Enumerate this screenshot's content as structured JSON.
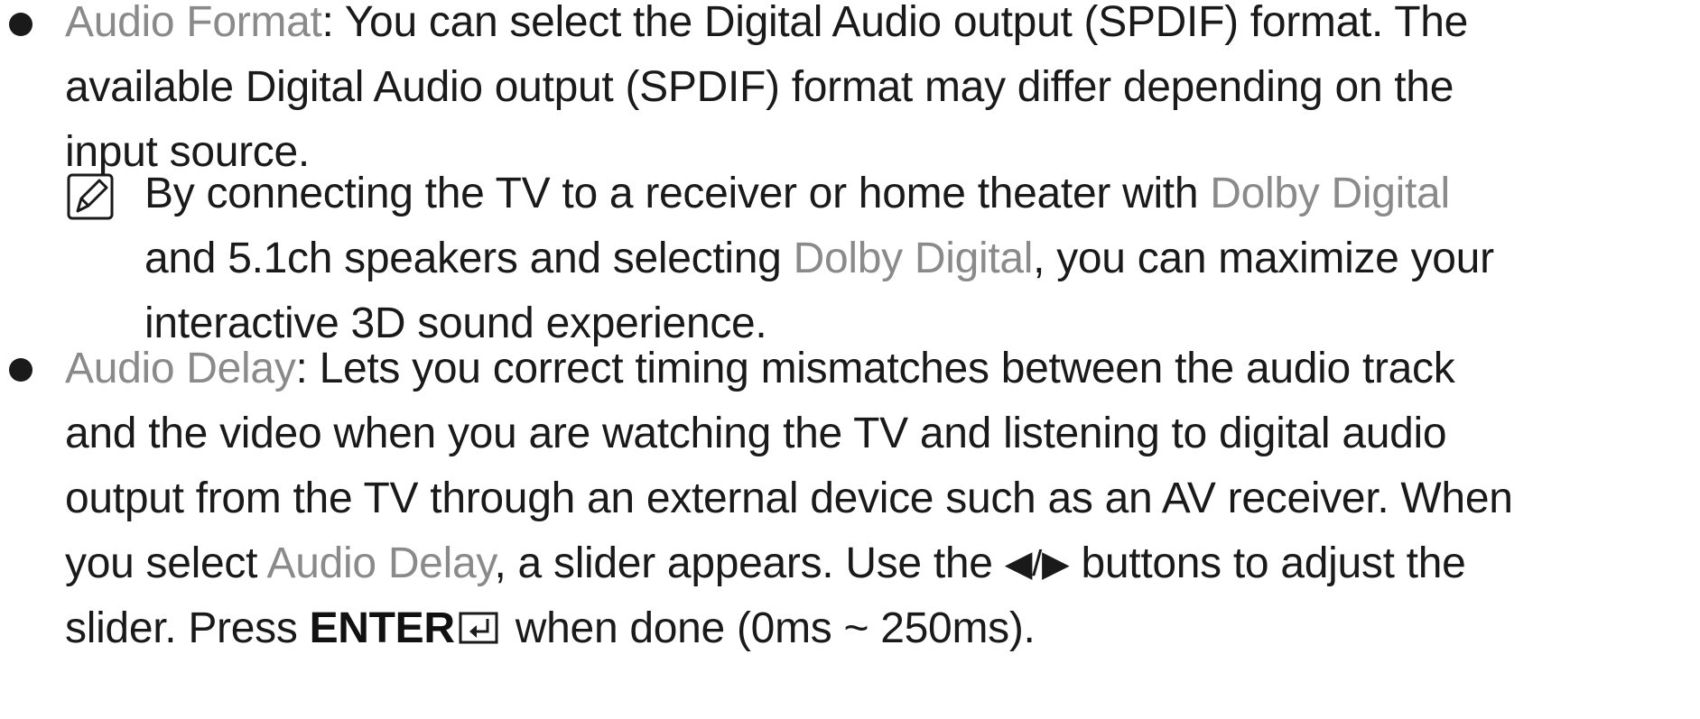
{
  "audio_format": {
    "term": "Audio Format",
    "line1_rest": ": You can select the Digital Audio output (SPDIF) format. The",
    "line2": "available Digital Audio output (SPDIF) format may differ depending on the",
    "line3": "input source."
  },
  "note": {
    "icon": "note-icon",
    "line1_pre": "By connecting the TV to a receiver or home theater with ",
    "term1": "Dolby Digital",
    "line2_pre": "and 5.1ch speakers and selecting ",
    "term2": "Dolby Digital",
    "line2_post": ", you can maximize your",
    "line3": "interactive 3D sound experience."
  },
  "audio_delay": {
    "term": "Audio Delay",
    "line1_rest": ": Lets you correct timing mismatches between the audio track",
    "line2": "and the video when you are watching the TV and listening to digital audio",
    "line3": "output from the TV through an external device such as an AV receiver. When",
    "line4_pre": "you select ",
    "line4_term": "Audio Delay",
    "line4_mid": ", a slider appears. Use the ",
    "arrows": "◀/▶",
    "line4_post": " buttons to adjust the",
    "line5_pre": "slider. Press ",
    "enter_label": "ENTER",
    "enter_icon": "enter-icon",
    "line5_post": " when done (0ms ~ 250ms)."
  },
  "colors": {
    "text": "#1a1a1a",
    "term": "#8a8a8a"
  }
}
